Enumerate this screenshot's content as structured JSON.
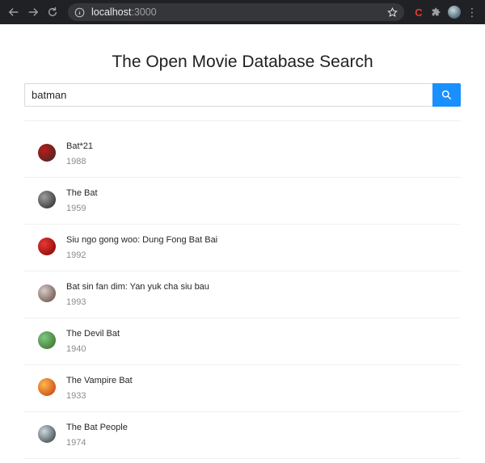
{
  "browser": {
    "url_host": "localhost",
    "url_port": ":3000",
    "extension_label": "C"
  },
  "page": {
    "title": "The Open Movie Database Search"
  },
  "search": {
    "value": "batman",
    "accent_color": "#1890ff"
  },
  "results": [
    {
      "title": "Bat*21",
      "year": "1988",
      "thumb_colors": [
        "#b71c1c",
        "#3e2723"
      ]
    },
    {
      "title": "The Bat",
      "year": "1959",
      "thumb_colors": [
        "#9e9e9e",
        "#212121"
      ]
    },
    {
      "title": "Siu ngo gong woo: Dung Fong Bat Bai",
      "year": "1992",
      "thumb_colors": [
        "#e53935",
        "#7f0000"
      ]
    },
    {
      "title": "Bat sin fan dim: Yan yuk cha siu bau",
      "year": "1993",
      "thumb_colors": [
        "#d7ccc8",
        "#5d4037"
      ]
    },
    {
      "title": "The Devil Bat",
      "year": "1940",
      "thumb_colors": [
        "#81c784",
        "#33691e"
      ]
    },
    {
      "title": "The Vampire Bat",
      "year": "1933",
      "thumb_colors": [
        "#ffb74d",
        "#bf360c"
      ]
    },
    {
      "title": "The Bat People",
      "year": "1974",
      "thumb_colors": [
        "#cfd8dc",
        "#263238"
      ]
    }
  ]
}
